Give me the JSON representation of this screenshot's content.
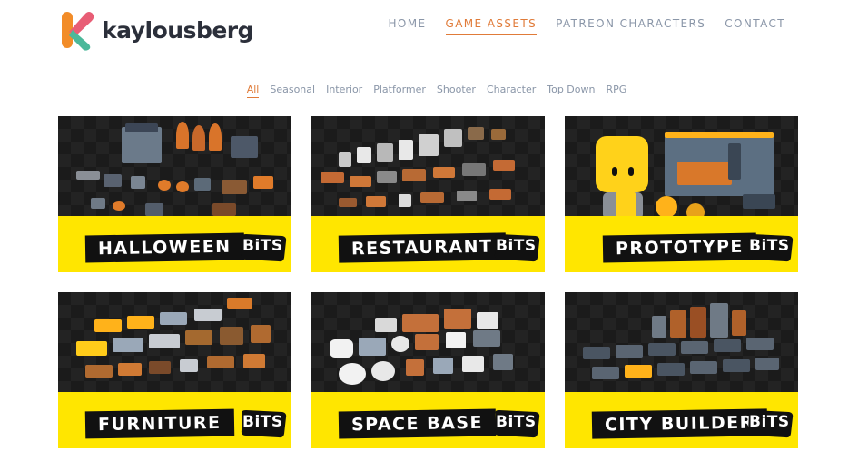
{
  "brand": {
    "name": "kaylousberg"
  },
  "nav": {
    "items": [
      {
        "label": "HOME",
        "active": false
      },
      {
        "label": "GAME ASSETS",
        "active": true
      },
      {
        "label": "PATREON CHARACTERS",
        "active": false
      },
      {
        "label": "CONTACT",
        "active": false
      }
    ]
  },
  "filters": {
    "items": [
      {
        "label": "All",
        "active": true
      },
      {
        "label": "Seasonal",
        "active": false
      },
      {
        "label": "Interior",
        "active": false
      },
      {
        "label": "Platformer",
        "active": false
      },
      {
        "label": "Shooter",
        "active": false
      },
      {
        "label": "Character",
        "active": false
      },
      {
        "label": "Top Down",
        "active": false
      },
      {
        "label": "RPG",
        "active": false
      }
    ]
  },
  "cards": [
    {
      "title": "HALLOWEEN",
      "badge": "BiTS"
    },
    {
      "title": "RESTAURANT",
      "badge": "BiTS"
    },
    {
      "title": "PROTOTYPE",
      "badge": "BiTS"
    },
    {
      "title": "FURNITURE",
      "badge": "BiTS"
    },
    {
      "title": "SPACE BASE",
      "badge": "BiTS"
    },
    {
      "title": "CITY BUILDER",
      "badge": "BiTS"
    }
  ],
  "colors": {
    "accent": "#e07b39",
    "nav_text": "#8a96a8",
    "banner_yellow": "#ffe600",
    "card_bg": "#151515"
  }
}
